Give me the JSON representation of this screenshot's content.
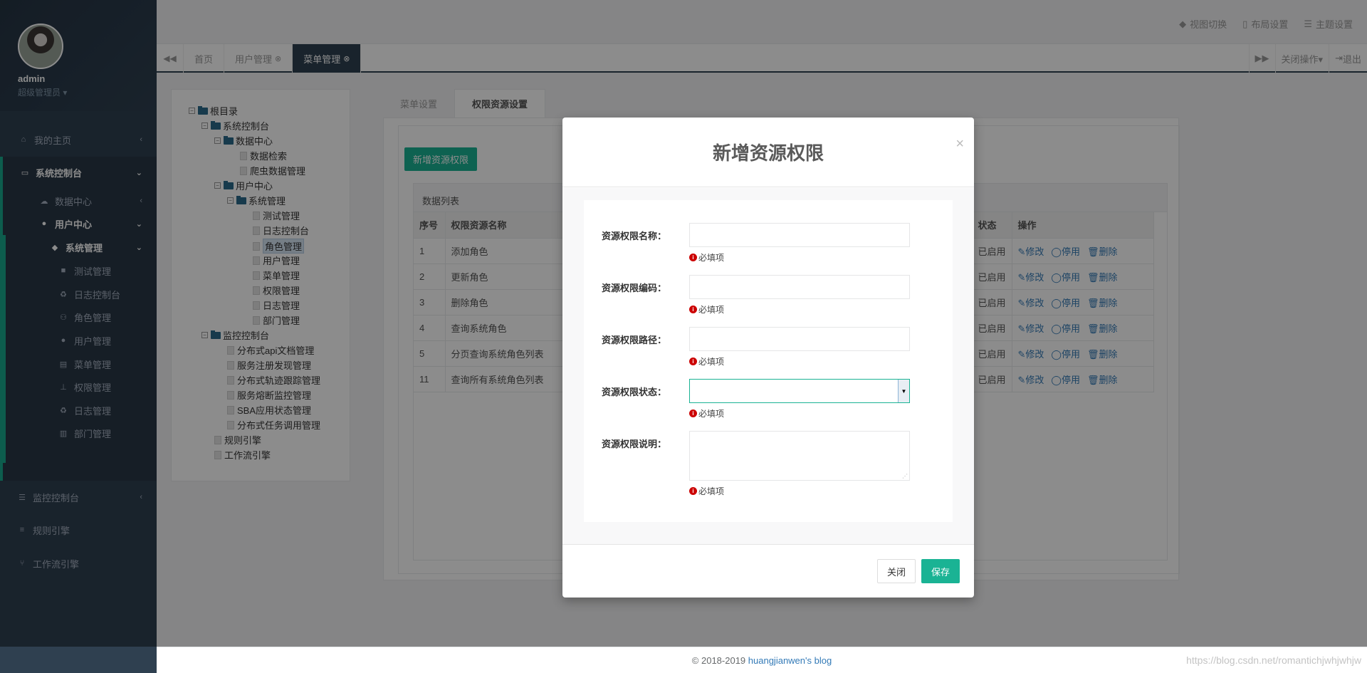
{
  "profile": {
    "name": "admin",
    "role": "超级管理员 ▾"
  },
  "sidebar": {
    "items": [
      {
        "label": "我的主页",
        "icon": "home-icon",
        "arrow": "‹"
      },
      {
        "label": "系统控制台",
        "icon": "monitor-icon",
        "arrow": "⌄"
      },
      {
        "label": "数据中心",
        "icon": "cloud-icon",
        "arrow": "‹"
      },
      {
        "label": "用户中心",
        "icon": "user-icon",
        "arrow": "⌄"
      },
      {
        "label": "系统管理",
        "icon": "dropbox-icon",
        "arrow": "⌄"
      },
      {
        "label": "测试管理",
        "icon": "square-icon"
      },
      {
        "label": "日志控制台",
        "icon": "recycle-icon"
      },
      {
        "label": "角色管理",
        "icon": "users-icon"
      },
      {
        "label": "用户管理",
        "icon": "user-icon"
      },
      {
        "label": "菜单管理",
        "icon": "card-icon"
      },
      {
        "label": "权限管理",
        "icon": "sitemap-icon"
      },
      {
        "label": "日志管理",
        "icon": "recycle-icon"
      },
      {
        "label": "部门管理",
        "icon": "bank-icon"
      },
      {
        "label": "监控控制台",
        "icon": "list-icon",
        "arrow": "‹"
      },
      {
        "label": "规则引擎",
        "icon": "database-icon"
      },
      {
        "label": "工作流引擎",
        "icon": "flow-icon"
      }
    ]
  },
  "topbar": {
    "view_switch": "视图切换",
    "layout": "布局设置",
    "theme": "主题设置"
  },
  "tabs": {
    "home": "首页",
    "user_mgmt": "用户管理",
    "menu_mgmt": "菜单管理",
    "close_ops": "关闭操作▾",
    "logout": "退出"
  },
  "tree": {
    "nodes": [
      "根目录",
      "系统控制台",
      "数据中心",
      "数据检索",
      "爬虫数据管理",
      "用户中心",
      "系统管理",
      "测试管理",
      "日志控制台",
      "角色管理",
      "用户管理",
      "菜单管理",
      "权限管理",
      "日志管理",
      "部门管理",
      "监控控制台",
      "分布式api文档管理",
      "服务注册发现管理",
      "分布式轨迹跟踪管理",
      "服务熔断监控管理",
      "SBA应用状态管理",
      "分布式任务调用管理",
      "规则引擎",
      "工作流引擎"
    ]
  },
  "panel": {
    "tab_menu": "菜单设置",
    "tab_perm": "权限资源设置",
    "add_button": "新增资源权限",
    "list_title": "数据列表",
    "columns": [
      "序号",
      "权限资源名称",
      "状态",
      "操作"
    ],
    "rows": [
      {
        "no": "1",
        "name": "添加角色",
        "status": "已启用"
      },
      {
        "no": "2",
        "name": "更新角色",
        "status": "已启用"
      },
      {
        "no": "3",
        "name": "删除角色",
        "status": "已启用"
      },
      {
        "no": "4",
        "name": "查询系统角色",
        "status": "已启用"
      },
      {
        "no": "5",
        "name": "分页查询系统角色列表",
        "status": "已启用"
      },
      {
        "no": "11",
        "name": "查询所有系统角色列表",
        "status": "已启用"
      }
    ],
    "op_edit": "修改",
    "op_disable": "停用",
    "op_delete": "删除"
  },
  "modal": {
    "title": "新增资源权限",
    "close_symbol": "×",
    "fields": [
      {
        "label": "资源权限名称：",
        "value": "",
        "hint": "必填项"
      },
      {
        "label": "资源权限编码：",
        "value": "",
        "hint": "必填项"
      },
      {
        "label": "资源权限路径：",
        "value": "",
        "hint": "必填项"
      },
      {
        "label": "资源权限状态：",
        "value": "",
        "hint": "必填项"
      },
      {
        "label": "资源权限说明：",
        "value": "",
        "hint": "必填项"
      }
    ],
    "btn_close": "关闭",
    "btn_save": "保存"
  },
  "footer": {
    "copyright": "© 2018-2019 ",
    "blog": "huangjianwen's blog",
    "watermark": "https://blog.csdn.net/romantichjwhjwhjw"
  },
  "colors": {
    "sidebar": "#2f4050",
    "accent": "#1ab394",
    "link": "#337ab7"
  }
}
